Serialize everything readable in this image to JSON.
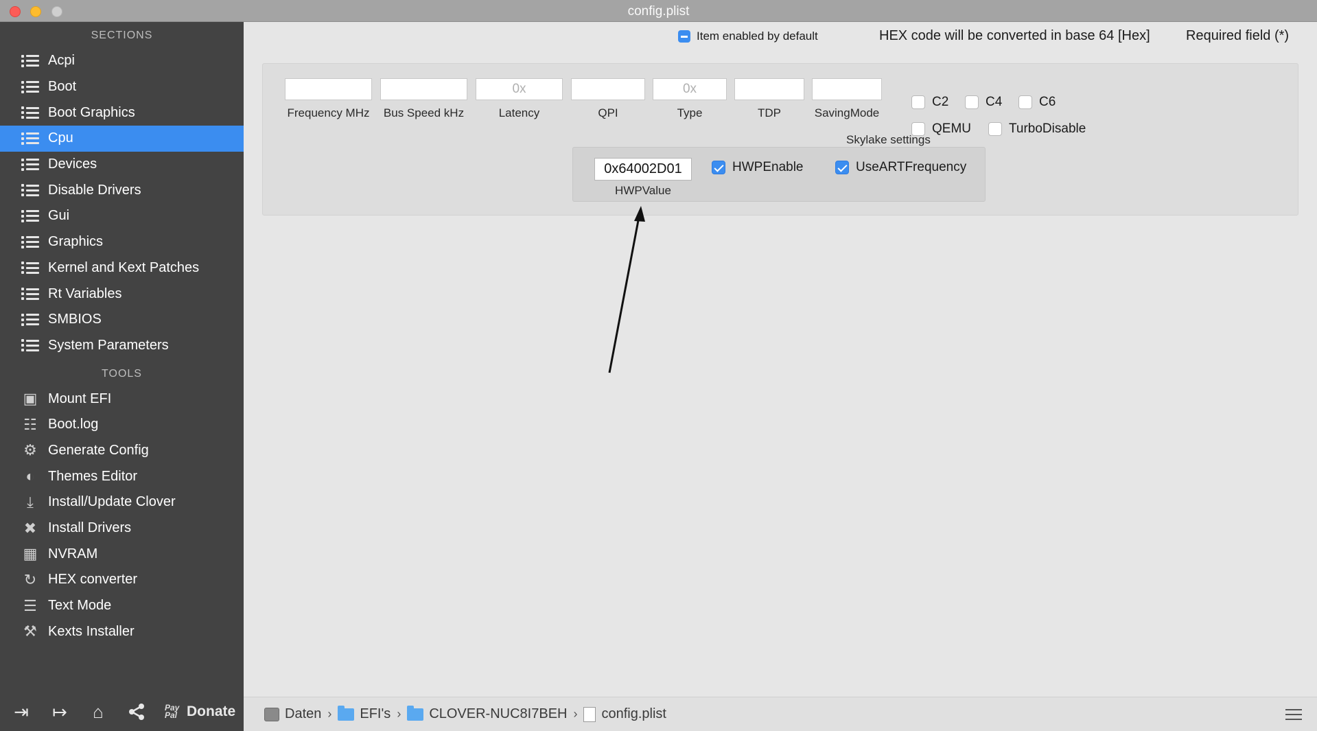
{
  "window": {
    "title": "config.plist"
  },
  "sidebar": {
    "sections_header": "SECTIONS",
    "sections": [
      "Acpi",
      "Boot",
      "Boot Graphics",
      "Cpu",
      "Devices",
      "Disable Drivers",
      "Gui",
      "Graphics",
      "Kernel and Kext Patches",
      "Rt Variables",
      "SMBIOS",
      "System Parameters"
    ],
    "active_section": "Cpu",
    "tools_header": "TOOLS",
    "tools": [
      {
        "label": "Mount EFI",
        "icon": "disk-icon"
      },
      {
        "label": "Boot.log",
        "icon": "log-search-icon"
      },
      {
        "label": "Generate Config",
        "icon": "gears-icon"
      },
      {
        "label": "Themes Editor",
        "icon": "palette-icon"
      },
      {
        "label": "Install/Update Clover",
        "icon": "download-icon"
      },
      {
        "label": "Install Drivers",
        "icon": "tools-icon"
      },
      {
        "label": "NVRAM",
        "icon": "chip-icon"
      },
      {
        "label": "HEX converter",
        "icon": "refresh-icon"
      },
      {
        "label": "Text Mode",
        "icon": "text-icon"
      },
      {
        "label": "Kexts Installer",
        "icon": "wrench-icon"
      }
    ],
    "footer": {
      "paypal": "Pay Pal",
      "donate": "Donate"
    }
  },
  "header": {
    "item_enabled": "Item enabled by default",
    "hex_note": "HEX code will be converted in base 64 [Hex]",
    "required_note": "Required field (*)"
  },
  "cpu": {
    "fields": [
      {
        "label": "Frequency MHz",
        "value": ""
      },
      {
        "label": "Bus Speed kHz",
        "value": ""
      },
      {
        "label": "Latency",
        "placeholder": "0x",
        "value": ""
      },
      {
        "label": "QPI",
        "value": ""
      },
      {
        "label": "Type",
        "placeholder": "0x",
        "value": ""
      },
      {
        "label": "TDP",
        "value": ""
      },
      {
        "label": "SavingMode",
        "value": ""
      }
    ],
    "checkboxes": [
      {
        "label": "C2",
        "checked": false
      },
      {
        "label": "C4",
        "checked": false
      },
      {
        "label": "C6",
        "checked": false
      },
      {
        "label": "QEMU",
        "checked": false
      },
      {
        "label": "TurboDisable",
        "checked": false
      }
    ],
    "skylake": {
      "title": "Skylake settings",
      "hwp_value": "0x64002D01",
      "hwp_label": "HWPValue",
      "hwp_enable": {
        "label": "HWPEnable",
        "checked": true
      },
      "use_art": {
        "label": "UseARTFrequency",
        "checked": true
      }
    }
  },
  "pathbar": {
    "crumbs": [
      "Daten",
      "EFI's",
      "CLOVER-NUC8I7BEH",
      "config.plist"
    ]
  },
  "colors": {
    "accent": "#3b8df0",
    "sidebar": "#434343"
  }
}
